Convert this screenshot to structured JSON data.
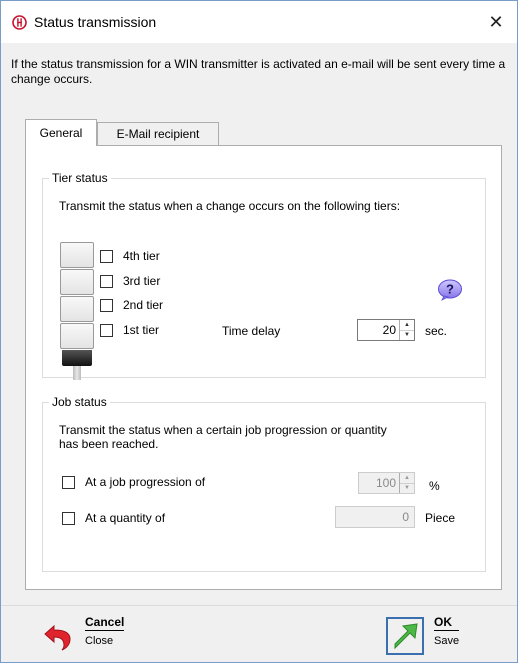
{
  "window": {
    "title": "Status transmission",
    "close_glyph": "✕",
    "info": "If the status transmission for a WIN transmitter is activated an e-mail will be sent every time a change occurs."
  },
  "tabs": [
    {
      "label": "General",
      "active": true
    },
    {
      "label": "E-Mail recipient",
      "active": false
    }
  ],
  "tier_status": {
    "title": "Tier status",
    "description": "Transmit the status when a change occurs on the following tiers:",
    "tiers": [
      {
        "label": "4th tier",
        "checked": false
      },
      {
        "label": "3rd tier",
        "checked": false
      },
      {
        "label": "2nd tier",
        "checked": false
      },
      {
        "label": "1st tier",
        "checked": false
      }
    ],
    "time_delay_label": "Time delay",
    "time_delay_value": "20",
    "time_delay_unit": "sec.",
    "help_icon": "question-bubble-icon"
  },
  "job_status": {
    "title": "Job status",
    "description": "Transmit the status when a certain job progression or quantity has been reached.",
    "progression_label": "At a job progression of",
    "progression_checked": false,
    "progression_value": "100",
    "progression_unit": "%",
    "quantity_label": "At a quantity of",
    "quantity_checked": false,
    "quantity_value": "0",
    "quantity_unit": "Piece"
  },
  "footer": {
    "cancel_label": "Cancel",
    "cancel_sub": "Close",
    "ok_label": "OK",
    "ok_sub": "Save"
  },
  "colors": {
    "cancel_icon": "#e0242e",
    "ok_icon": "#4db848",
    "help_icon": "#5b4bd6"
  }
}
